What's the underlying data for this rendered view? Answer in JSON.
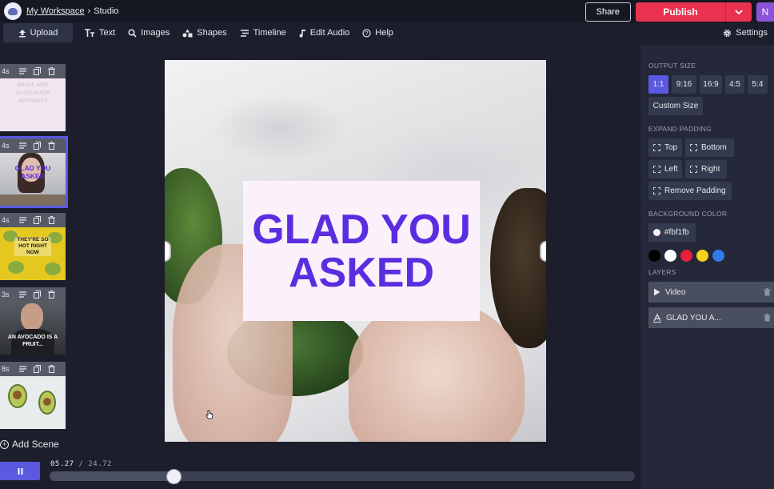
{
  "topbar": {
    "workspace_link": "My Workspace",
    "separator": "›",
    "page": "Studio",
    "share_label": "Share",
    "publish_label": "Publish",
    "avatar_initial": "N"
  },
  "toolbar": {
    "upload": "Upload",
    "text": "Text",
    "images": "Images",
    "shapes": "Shapes",
    "timeline": "Timeline",
    "edit_audio": "Edit Audio",
    "help": "Help",
    "settings": "Settings"
  },
  "scenes": [
    {
      "duration": "4s",
      "caption": "WHAT ARE AVOCADOS ANYWAY?",
      "bg": "#f3e6f1",
      "caption_color": "#d8c9d6"
    },
    {
      "duration": "4s",
      "caption": "GLAD YOU ASKED",
      "bg": "#c7c9cc",
      "caption_color": "#5b2de0"
    },
    {
      "duration": "4s",
      "caption": "THEY'RE SO HOT RIGHT NOW",
      "bg": "#e4c81f",
      "caption_color": "#1a1a1a"
    },
    {
      "duration": "3s",
      "caption": "AN AVOCADO IS A FRUIT...",
      "bg": "#3b3d44",
      "caption_color": "#ffffff"
    },
    {
      "duration": "8s",
      "caption": "",
      "bg": "#e8ecec",
      "caption_color": "#ffffff"
    }
  ],
  "add_scene_label": "Add Scene",
  "canvas": {
    "headline": "GLAD YOU ASKED",
    "text_color": "#5b2de0",
    "box_color": "#fbf1fb"
  },
  "right_panel": {
    "output_size_label": "OUTPUT SIZE",
    "sizes": [
      "1:1",
      "9:16",
      "16:9",
      "4:5",
      "5:4"
    ],
    "selected_size": "1:1",
    "custom_size": "Custom Size",
    "expand_padding_label": "EXPAND PADDING",
    "padding": {
      "top": "Top",
      "bottom": "Bottom",
      "left": "Left",
      "right": "Right",
      "remove": "Remove Padding"
    },
    "background_color_label": "BACKGROUND COLOR",
    "background_color_value": "#fbf1fb",
    "swatches": [
      "#000000",
      "#ffffff",
      "#e8203a",
      "#f5d21a",
      "#2f7be8"
    ],
    "layers_label": "LAYERS",
    "layers": [
      {
        "icon": "play-icon",
        "name": "Video"
      },
      {
        "icon": "text-layer-icon",
        "name": "GLAD YOU A..."
      }
    ]
  },
  "timeline": {
    "current": "05.27",
    "separator": "/",
    "total": "24.72",
    "progress": 0.213
  }
}
